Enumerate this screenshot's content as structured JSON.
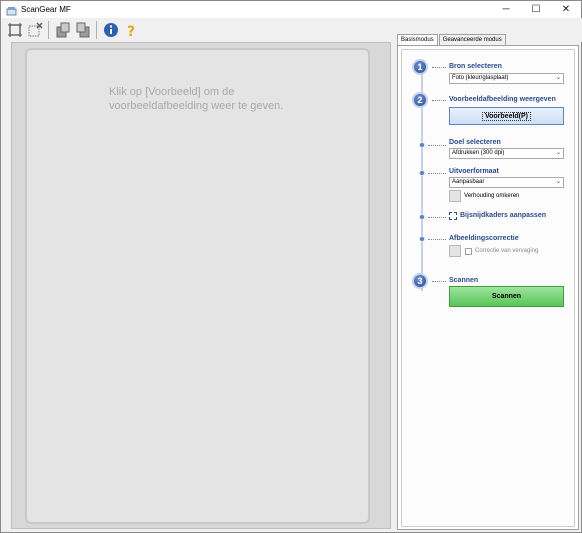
{
  "window": {
    "title": "ScanGear MF",
    "minimize": "─",
    "maximize": "☐",
    "close": "✕"
  },
  "toolbar": {
    "items": [
      "auto-crop-icon",
      "remove-crop-icon",
      "rotate-left-icon",
      "rotate-right-icon",
      "info-icon",
      "help-icon"
    ]
  },
  "preview": {
    "message": "Klik op [Voorbeeld] om de voorbeeldafbeelding weer te geven."
  },
  "tabs": [
    {
      "label": "Basismodus",
      "active": true
    },
    {
      "label": "Geavanceerde modus",
      "active": false
    }
  ],
  "steps": {
    "step1": {
      "number": "1",
      "label": "Bron selecteren"
    },
    "source": {
      "value": "Foto (kleur/glasplaat)"
    },
    "step2": {
      "number": "2",
      "label": "Voorbeeldafbeelding weergeven"
    },
    "preview_button": "Voorbeeld(P)",
    "destination": {
      "label": "Doel selecteren",
      "value": "Afdrukken (300 dpi)"
    },
    "output_size": {
      "label": "Uitvoerformaat",
      "value": "Aanpasbaar",
      "ratio_label": "Verhouding omkeren"
    },
    "crop": {
      "label": "Bijsnijdkaders aanpassen"
    },
    "correction": {
      "label": "Afbeeldingscorrectie",
      "fade_label": "Correctie van vervaging"
    },
    "step3": {
      "number": "3",
      "label": "Scannen"
    },
    "scan_button": "Scannen"
  },
  "colors": {
    "accent": "#2d4b8c",
    "scan_green": "#57c657",
    "step_blue": "#2a4f9a"
  }
}
